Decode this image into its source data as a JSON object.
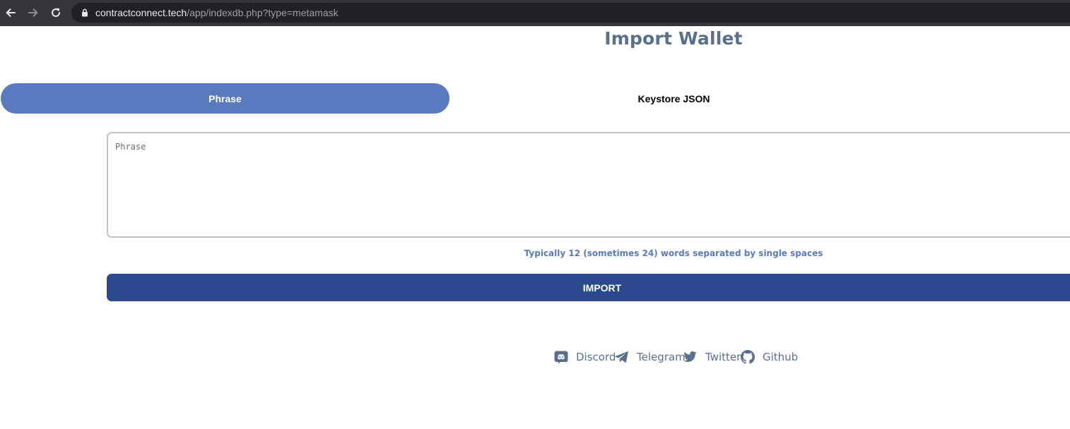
{
  "browser": {
    "url_host": "contractconnect.tech",
    "url_path": "/app/indexdb.php?type=metamask"
  },
  "page": {
    "title": "Import Wallet"
  },
  "tabs": [
    {
      "label": "Phrase",
      "active": true
    },
    {
      "label": "Keystore JSON",
      "active": false
    }
  ],
  "phrase_field": {
    "placeholder": "Phrase",
    "value": ""
  },
  "hint_text": "Typically 12 (sometimes 24) words separated by single spaces",
  "import_button": {
    "label": "IMPORT"
  },
  "social_links": [
    {
      "label": "Discord",
      "icon": "discord-icon"
    },
    {
      "label": "Telegram",
      "icon": "telegram-icon"
    },
    {
      "label": "Twitter",
      "icon": "twitter-icon"
    },
    {
      "label": "Github",
      "icon": "github-icon"
    }
  ],
  "colors": {
    "accent": "#5a7abe",
    "import_button": "#2b4a8e",
    "title": "#5a6f8c",
    "link": "#5a6f9e"
  }
}
